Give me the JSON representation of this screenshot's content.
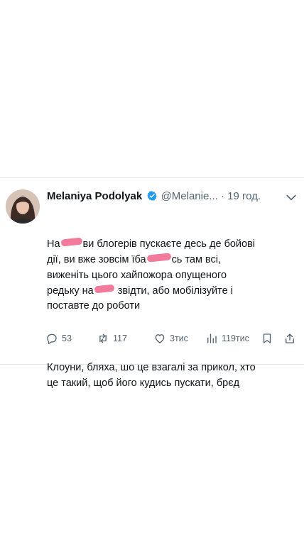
{
  "tweet": {
    "display_name": "Melaniya Podolyak",
    "handle": "@Melanie...",
    "separator": "·",
    "time": "19 год.",
    "text": {
      "line1_a": "На",
      "line1_b": "ви блогерів пускаєте десь де бойові",
      "line2_a": "дії, ви вже зовсім їба",
      "line2_b": "сь там всі,",
      "line3": "виженіть цього хайпожора опущеного",
      "line4_a": "редьку на",
      "line4_b": " звідти, або мобілізуйте і",
      "line5": "поставте до роботи",
      "para2_line1": "Клоуни, бляха, шо це взагалі за прикол, хто",
      "para2_line2": "це такий, щоб його кудись пускати, брєд"
    },
    "censor_color": "#f27a9c",
    "icons": {
      "verified": "verified-badge-icon",
      "more": "more-icon",
      "reply": "reply-icon",
      "repost": "repost-icon",
      "like": "like-icon",
      "views": "views-icon",
      "bookmark": "bookmark-icon",
      "share": "share-icon"
    },
    "stats": {
      "replies": "53",
      "reposts": "117",
      "likes": "3тис",
      "views": "119тис"
    }
  },
  "colors": {
    "primary_text": "#0f1419",
    "secondary_text": "#536471",
    "verified_blue": "#1d9bf0"
  }
}
